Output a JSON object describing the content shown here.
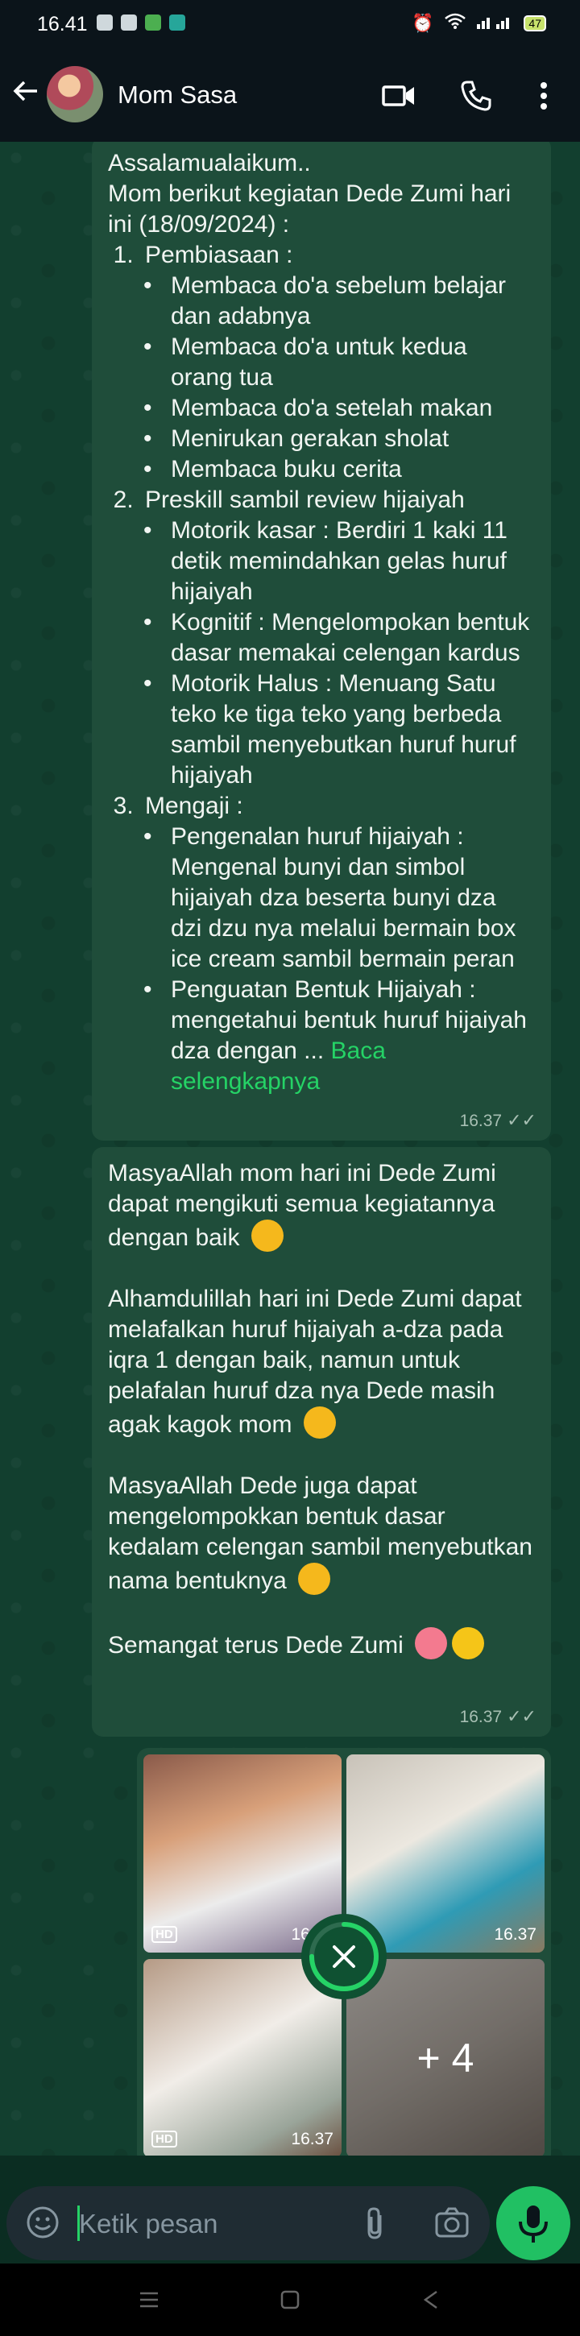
{
  "status_bar": {
    "time": "16.41",
    "battery": "47"
  },
  "header": {
    "contact_name": "Mom Sasa",
    "icons": [
      "back-arrow-icon",
      "video-call-icon",
      "voice-call-icon",
      "more-options-icon"
    ]
  },
  "messages": {
    "incoming": {
      "greeting": "Assalamualaikum..",
      "intro": "Mom berikut kegiatan Dede Zumi hari ini (18/09/2024) :",
      "sections": [
        {
          "title": "Pembiasaan :",
          "items": [
            "Membaca do'a sebelum belajar dan adabnya",
            "Membaca do'a untuk kedua orang tua",
            "Membaca do'a setelah makan",
            "Menirukan gerakan sholat",
            "Membaca buku cerita"
          ]
        },
        {
          "title": "Preskill sambil review hijaiyah",
          "items": [
            "Motorik kasar :  Berdiri 1 kaki 11 detik memindahkan gelas huruf hijaiyah",
            "Kognitif : Mengelompokan bentuk dasar memakai celengan kardus",
            "Motorik Halus :   Menuang Satu teko ke tiga teko yang berbeda sambil menyebutkan huruf huruf hijaiyah"
          ]
        },
        {
          "title": "Mengaji :",
          "items": [
            "Pengenalan huruf hijaiyah : Mengenal bunyi dan simbol hijaiyah dza beserta bunyi dza dzi dzu nya melalui bermain box ice cream sambil bermain peran"
          ]
        }
      ],
      "truncated_item": "Penguatan Bentuk Hijaiyah : mengetahui bentuk huruf hijaiyah dza dengan ...",
      "read_more": "Baca selengkapnya",
      "time": "16.37"
    },
    "reply": {
      "paragraphs": [
        "MasyaAllah mom hari ini Dede Zumi dapat mengikuti semua kegiatannya dengan baik",
        "Alhamdulillah hari ini Dede Zumi dapat melafalkan huruf hijaiyah a-dza pada iqra 1 dengan baik, namun untuk pelafalan huruf dza nya Dede masih agak kagok mom",
        "MasyaAllah Dede juga dapat mengelompokkan bentuk dasar kedalam celengan sambil menyebutkan nama bentuknya",
        "Semangat terus Dede Zumi"
      ],
      "emojis": [
        "smiling-face-icon",
        "smiling-face-icon",
        "smiling-face-icon",
        "smiling-face-with-hearts-icon",
        "hugging-face-icon"
      ],
      "time": "16.37"
    },
    "media": {
      "tiles": [
        {
          "badge": "HD",
          "time": "16.37"
        },
        {
          "time": "16.37"
        },
        {
          "badge": "HD",
          "time": "16.37"
        },
        {
          "more": "+ 4"
        }
      ],
      "upload_progress": 0.75
    }
  },
  "composer": {
    "placeholder": "Ketik pesan"
  }
}
